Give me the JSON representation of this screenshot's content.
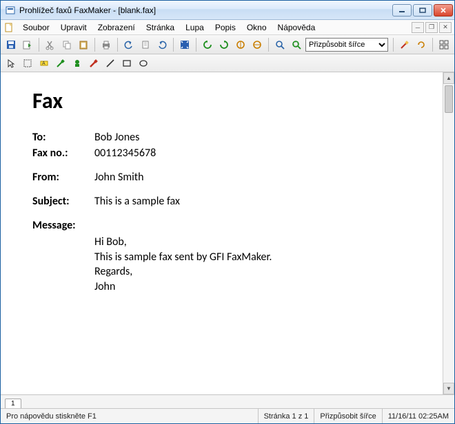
{
  "window": {
    "title": "Prohlížeč faxů FaxMaker - [blank.fax]"
  },
  "menu": {
    "items": [
      "Soubor",
      "Upravit",
      "Zobrazení",
      "Stránka",
      "Lupa",
      "Popis",
      "Okno",
      "Nápověda"
    ]
  },
  "toolbar": {
    "zoom_selected": "Přizpůsobit šířce"
  },
  "document": {
    "heading": "Fax",
    "labels": {
      "to": "To:",
      "faxno": "Fax no.:",
      "from": "From:",
      "subject": "Subject:",
      "message": "Message:"
    },
    "to": "Bob Jones",
    "faxno": "00112345678",
    "from": "John Smith",
    "subject": "This is a sample fax",
    "message_lines": [
      "Hi Bob,",
      "This is sample fax sent by GFI FaxMaker.",
      "Regards,",
      "John"
    ]
  },
  "tabs": {
    "page1": "1"
  },
  "status": {
    "help": "Pro nápovědu stiskněte F1",
    "page": "Stránka 1 z 1",
    "zoom": "Přizpůsobit šířce",
    "datetime": "11/16/11 02:25AM"
  }
}
